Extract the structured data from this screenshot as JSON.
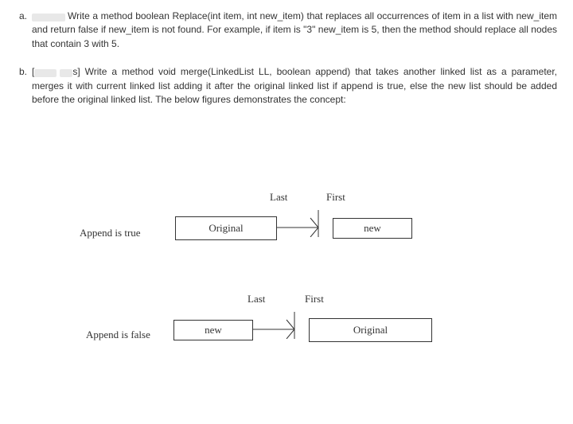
{
  "problems": {
    "a": {
      "letter": "a.",
      "text": "Write a method boolean Replace(int item, int new_item) that replaces all occurrences of item in a list with new_item and return false if new_item is not found. For example, if item is \"3\" new_item is 5, then the method should replace all nodes that contain 3 with 5."
    },
    "b": {
      "letter": "b.",
      "lead": "[",
      "lead2": "s]",
      "text": " Write a method void merge(LinkedList LL, boolean append) that takes another linked list as a parameter, merges it with current linked list adding it after the original linked list if append is true, else the new list should be added before the original linked list. The below figures demonstrates the concept:"
    }
  },
  "diagram": {
    "row1": {
      "label": "Append is true",
      "box1": "Original",
      "box2": "new",
      "topLabel1": "Last",
      "topLabel2": "First"
    },
    "row2": {
      "label": "Append is false",
      "box1": "new",
      "box2": "Original",
      "topLabel1": "Last",
      "topLabel2": "First"
    }
  }
}
